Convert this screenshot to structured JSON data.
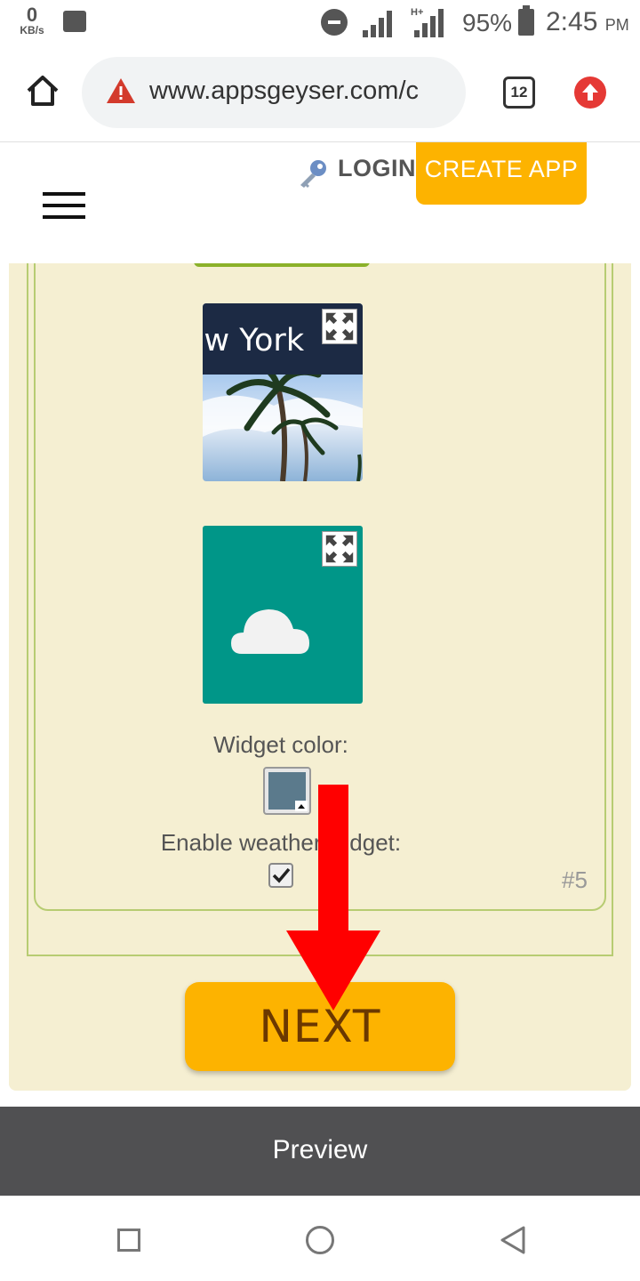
{
  "status_bar": {
    "speed_value": "0",
    "speed_unit": "KB/s",
    "network_type": "H+",
    "battery": "95%",
    "time": "2:45",
    "ampm": "PM"
  },
  "browser": {
    "url": "www.appsgeyser.com/c",
    "tab_count": "12"
  },
  "header": {
    "login_label": "LOGIN",
    "create_app_label": "CREATE APP"
  },
  "widgets": {
    "photo_title": "ew York",
    "color_label": "Widget color:",
    "color_value": "#5b7a8c",
    "enable_label": "Enable weather widget:",
    "enable_checked": true,
    "index": "#5"
  },
  "next_label": "NEXT",
  "preview_label": "Preview",
  "colors": {
    "accent": "#fdb300",
    "panel_bg": "#f5efd2",
    "border_green": "#b7cc72",
    "teal": "#009688",
    "arrow_red": "#ff0000"
  }
}
